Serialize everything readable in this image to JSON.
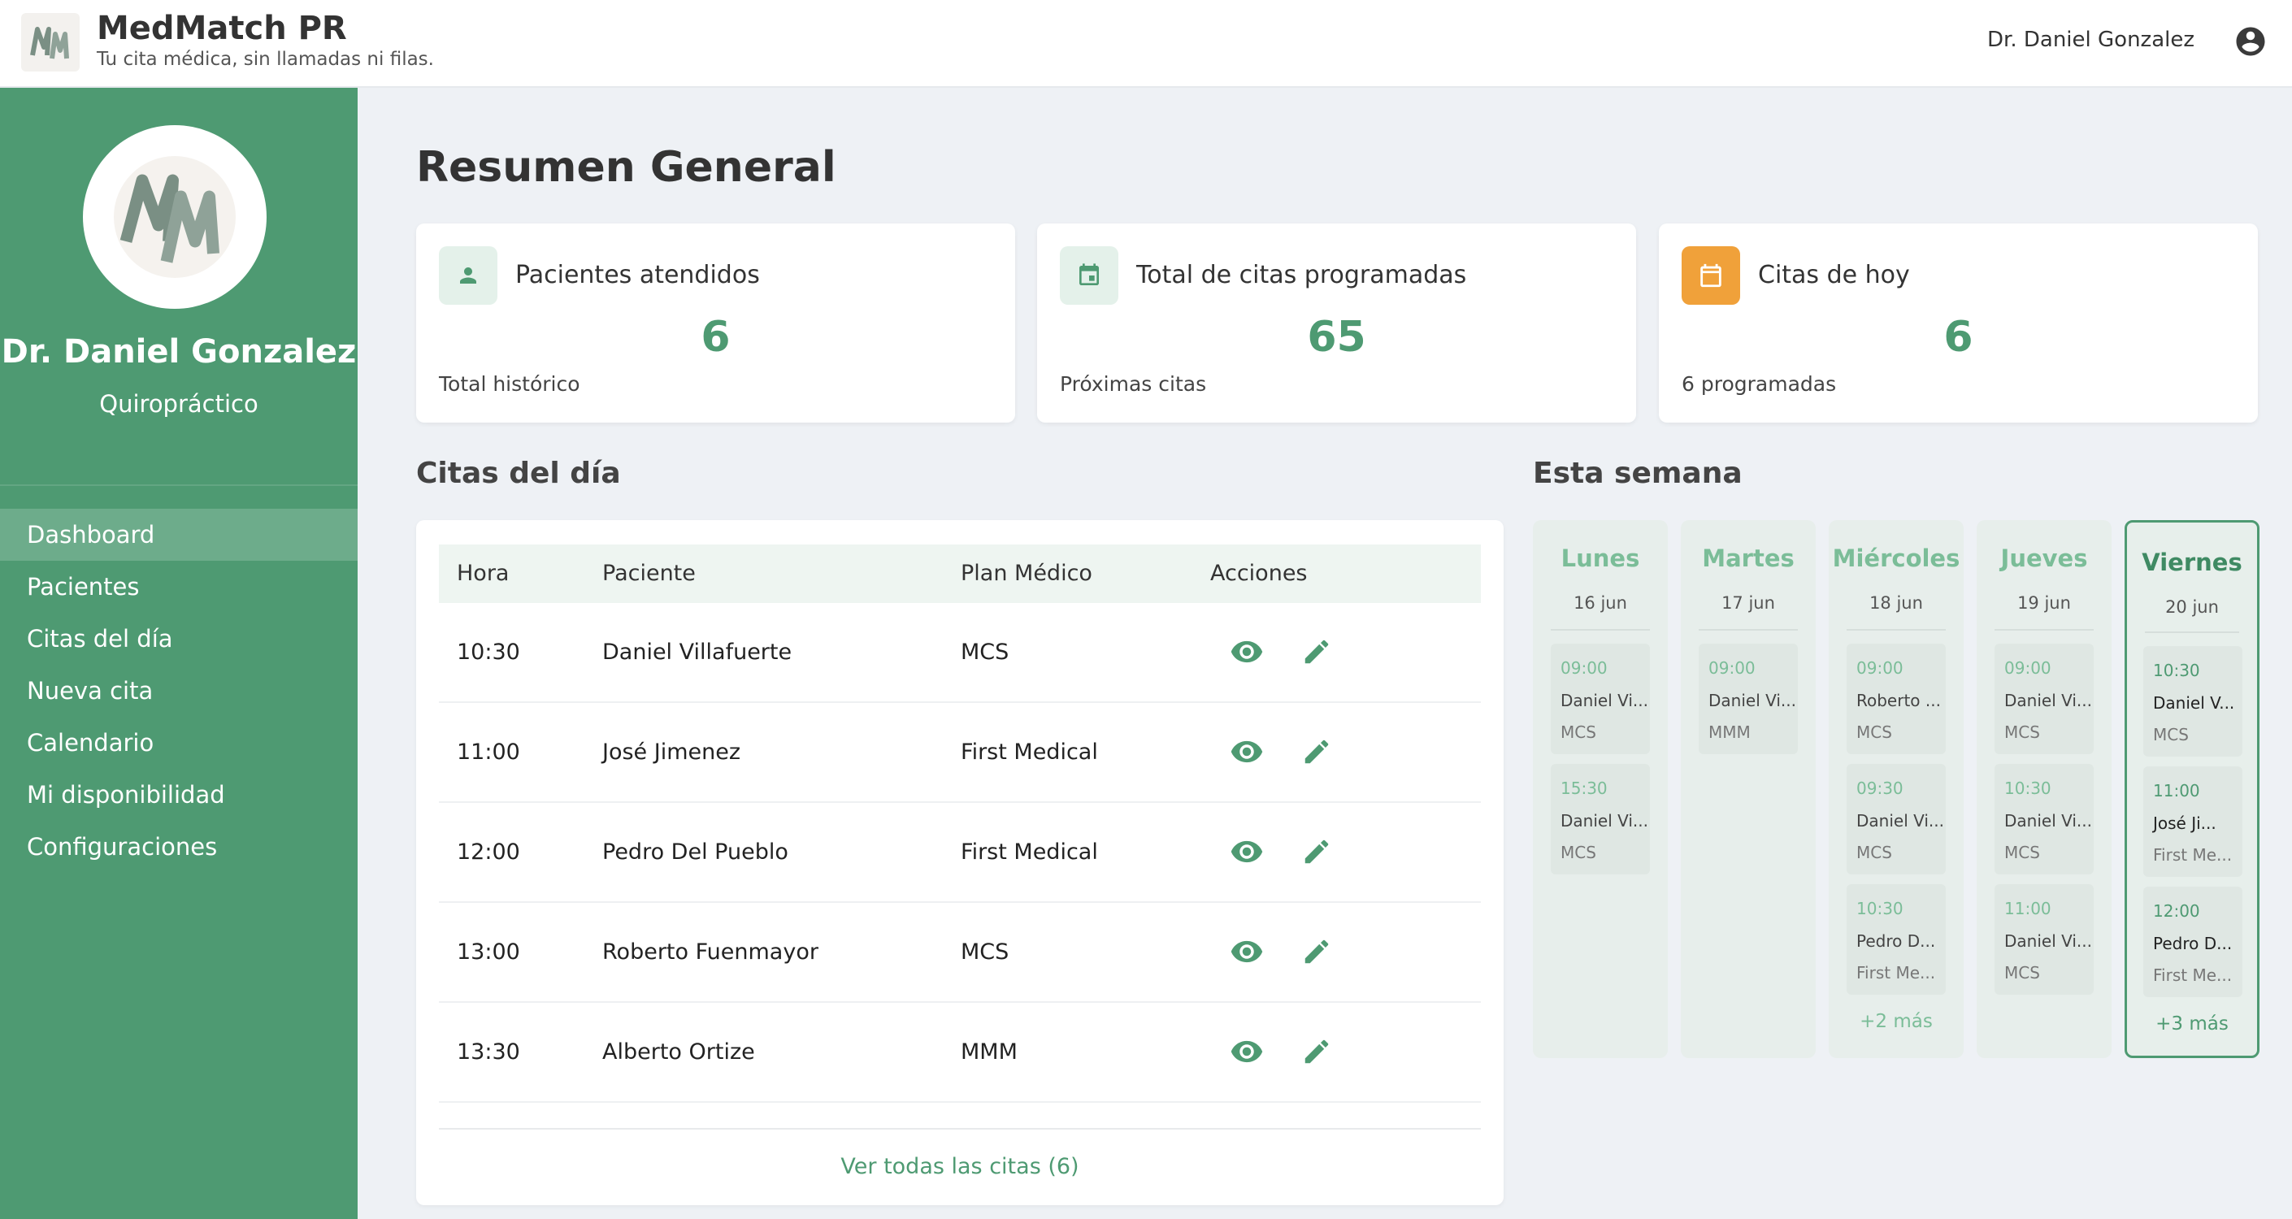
{
  "header": {
    "brand_title": "MedMatch PR",
    "brand_subtitle": "Tu cita médica, sin llamadas ni filas.",
    "user_name": "Dr. Daniel Gonzalez",
    "icons": {
      "logo": "mm-logo-icon",
      "account": "account-circle-icon"
    }
  },
  "sidebar": {
    "doctor_name": "Dr. Daniel Gonzalez",
    "specialty": "Quiropráctico",
    "nav": [
      {
        "label": "Dashboard",
        "active": true
      },
      {
        "label": "Pacientes"
      },
      {
        "label": "Citas del día"
      },
      {
        "label": "Nueva cita"
      },
      {
        "label": "Calendario"
      },
      {
        "label": "Mi disponibilidad"
      },
      {
        "label": "Configuraciones"
      }
    ]
  },
  "main": {
    "title": "Resumen General",
    "stats": [
      {
        "label": "Pacientes atendidos",
        "value": "6",
        "foot": "Total histórico",
        "icon": "person-icon"
      },
      {
        "label": "Total de citas programadas",
        "value": "65",
        "foot": "Próximas citas",
        "icon": "calendar-event-icon"
      },
      {
        "label": "Citas de hoy",
        "value": "6",
        "foot": "6 programadas",
        "icon": "calendar-icon"
      }
    ],
    "appointments": {
      "title": "Citas del día",
      "columns": [
        "Hora",
        "Paciente",
        "Plan Médico",
        "Acciones"
      ],
      "rows": [
        {
          "time": "10:30",
          "patient": "Daniel Villafuerte",
          "plan": "MCS"
        },
        {
          "time": "11:00",
          "patient": "José Jimenez",
          "plan": "First Medical"
        },
        {
          "time": "12:00",
          "patient": "Pedro Del Pueblo",
          "plan": "First Medical"
        },
        {
          "time": "13:00",
          "patient": "Roberto Fuenmayor",
          "plan": "MCS"
        },
        {
          "time": "13:30",
          "patient": "Alberto Ortize",
          "plan": "MMM"
        }
      ],
      "view_all": "Ver todas las citas (6)"
    },
    "week": {
      "title": "Esta semana",
      "days": [
        {
          "name": "Lunes",
          "date": "16 jun",
          "appts": [
            {
              "time": "09:00",
              "name": "Daniel Vi...",
              "plan": "MCS"
            },
            {
              "time": "15:30",
              "name": "Daniel Vi...",
              "plan": "MCS"
            }
          ],
          "more": ""
        },
        {
          "name": "Martes",
          "date": "17 jun",
          "appts": [
            {
              "time": "09:00",
              "name": "Daniel Vi...",
              "plan": "MMM"
            }
          ],
          "more": ""
        },
        {
          "name": "Miércoles",
          "date": "18 jun",
          "appts": [
            {
              "time": "09:00",
              "name": "Roberto ...",
              "plan": "MCS"
            },
            {
              "time": "09:30",
              "name": "Daniel Vi...",
              "plan": "MCS"
            },
            {
              "time": "10:30",
              "name": "Pedro D...",
              "plan": "First Me..."
            }
          ],
          "more": "+2 más"
        },
        {
          "name": "Jueves",
          "date": "19 jun",
          "appts": [
            {
              "time": "09:00",
              "name": "Daniel Vi...",
              "plan": "MCS"
            },
            {
              "time": "10:30",
              "name": "Daniel Vi...",
              "plan": "MCS"
            },
            {
              "time": "11:00",
              "name": "Daniel Vi...",
              "plan": "MCS"
            }
          ],
          "more": ""
        },
        {
          "name": "Viernes",
          "date": "20 jun",
          "today": true,
          "appts": [
            {
              "time": "10:30",
              "name": "Daniel V...",
              "plan": "MCS"
            },
            {
              "time": "11:00",
              "name": "José Ji...",
              "plan": "First Me..."
            },
            {
              "time": "12:00",
              "name": "Pedro D...",
              "plan": "First Me..."
            }
          ],
          "more": "+3 más"
        }
      ]
    }
  },
  "colors": {
    "primary": "#4e9a72",
    "accent_orange": "#f0a13a",
    "background": "#eef1f5"
  }
}
